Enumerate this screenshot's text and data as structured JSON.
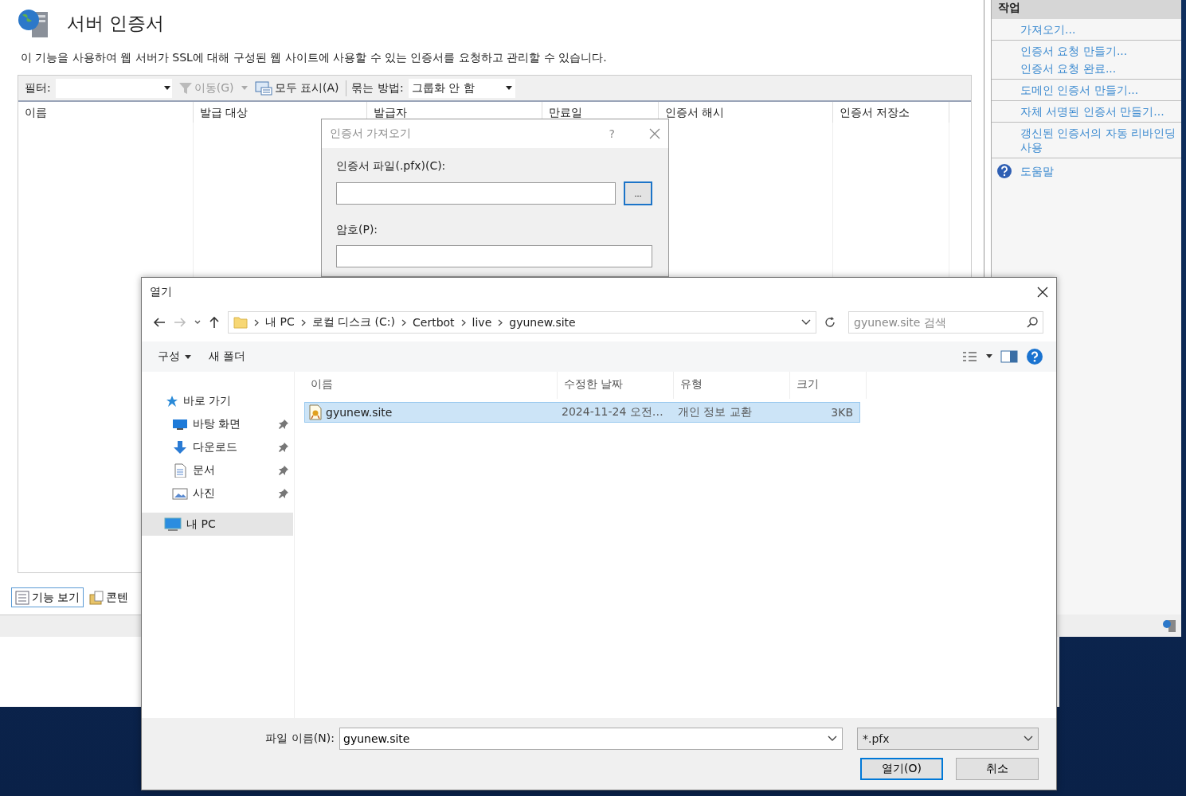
{
  "iis": {
    "title": "서버 인증서",
    "description": "이 기능을 사용하여 웹 서버가 SSL에 대해 구성된 웹 사이트에 사용할 수 있는 인증서를 요청하고 관리할 수 있습니다.",
    "filter_label": "필터:",
    "toolbar": [
      {
        "kind": "go",
        "label": "이동(G)",
        "disabled": true
      },
      {
        "kind": "show_all",
        "label": "모두 표시(A)",
        "disabled": false
      }
    ],
    "group_by": {
      "label": "묶는 방법:",
      "value": "그룹화 안 함"
    },
    "columns": [
      "이름",
      "발급 대상",
      "발급자",
      "만료일",
      "인증서 해시",
      "인증서 저장소"
    ],
    "view_tabs": [
      {
        "label": "기능 보기",
        "selected": true
      },
      {
        "label": "콘텐",
        "selected": false
      }
    ]
  },
  "actions": {
    "title": "작업",
    "groups": [
      [
        "가져오기..."
      ],
      [
        "인증서 요청 만들기...",
        "인증서 요청 완료..."
      ],
      [
        "도메인 인증서 만들기..."
      ],
      [
        "자체 서명된 인증서 만들기..."
      ],
      [
        "갱신된 인증서의 자동 리바인딩 사용"
      ]
    ],
    "help": "도움말"
  },
  "import_dialog": {
    "title": "인증서 가져오기",
    "help": "?",
    "file_label": "인증서 파일(.pfx)(C):",
    "browse": "...",
    "password_label": "암호(P):"
  },
  "open_dialog": {
    "title": "열기",
    "breadcrumb": [
      "내 PC",
      "로컬 디스크 (C:)",
      "Certbot",
      "live",
      "gyunew.site"
    ],
    "search": {
      "placeholder": "gyunew.site 검색"
    },
    "organize": "구성",
    "new_folder": "새 폴더",
    "quick_access": {
      "label": "바로 가기",
      "children": [
        {
          "label": "바탕 화면",
          "kind": "desktop",
          "pinned": true
        },
        {
          "label": "다운로드",
          "kind": "download",
          "pinned": true
        },
        {
          "label": "문서",
          "kind": "document",
          "pinned": true
        },
        {
          "label": "사진",
          "kind": "pictures",
          "pinned": true
        }
      ]
    },
    "this_pc": {
      "label": "내 PC",
      "selected": true
    },
    "columns": [
      "이름",
      "수정한 날짜",
      "유형",
      "크기"
    ],
    "files": [
      {
        "name": "gyunew.site",
        "modified": "2024-11-24 오전…",
        "type": "개인 정보 교환",
        "size": "3KB",
        "selected": true
      }
    ],
    "filename_label": "파일 이름(N):",
    "filename": "gyunew.site",
    "file_type": "*.pfx",
    "buttons": [
      {
        "label": "열기(O)",
        "kind": "primary"
      },
      {
        "label": "취소",
        "kind": "normal"
      }
    ]
  }
}
